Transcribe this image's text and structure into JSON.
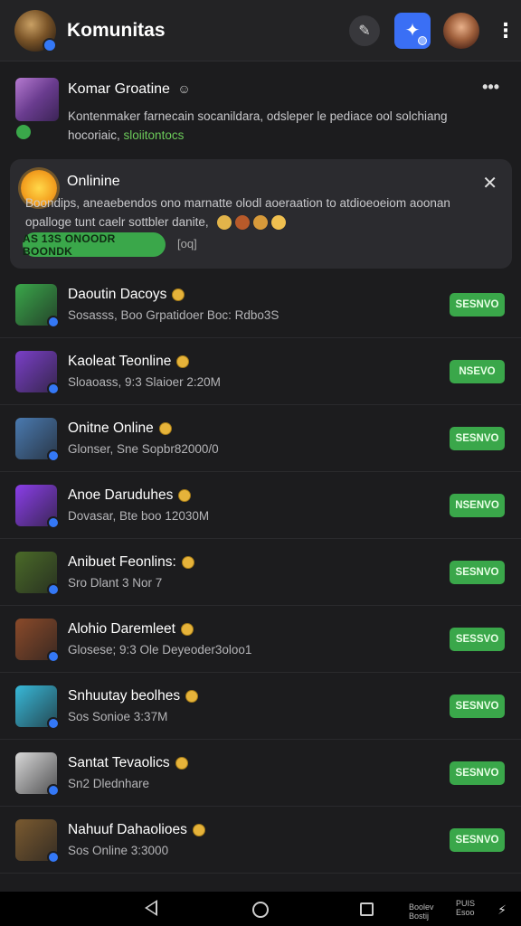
{
  "header": {
    "title": "Komunitas",
    "search_icon": "pen-icon",
    "compose_icon": "star-icon"
  },
  "post": {
    "title": "Komar Groatine",
    "title_suffix": "☺",
    "body": "Kontenmaker farnecain socanildara, odsleper le pediace ool solchiang hocoriaic,",
    "link": "sloiitontocs",
    "more": "•••"
  },
  "online_card": {
    "title": "Onlinine",
    "body": "Boondips, aneaebendos ono marnatte olodl aoeraation to atdioeoeiom aoonan opalloge tunt caelr sottbler danite,",
    "button": "AS 13S ONOODR BOONDK",
    "aux": "[oq]",
    "close": "✕",
    "dot_colors": [
      "#e2b44a",
      "#b85a2a",
      "#d79a3a",
      "#f0c050"
    ]
  },
  "rows": [
    {
      "name": "Daoutin Dacoys",
      "sub": "Sosasss, Boo Grpatidoer Boc: Rdbo3S",
      "button": "SESNVO",
      "icon_color": "#3aa74a"
    },
    {
      "name": "Kaoleat Teonline",
      "sub": "Sloaoass, 9:3 Slaioer 2:20M",
      "button": "NSEVO",
      "icon_color": "#7a3fc8"
    },
    {
      "name": "Onitne Online",
      "sub": "Glonser, Sne Sopbr82000/0",
      "button": "SESNVO",
      "icon_color": "#4a7ab0"
    },
    {
      "name": "Anoe Daruduhes",
      "sub": "Dovasar, Bte boo 12030M",
      "button": "NSENVO",
      "icon_color": "#8a3ee8"
    },
    {
      "name": "Anibuet Feonlins:",
      "sub": "Sro Dlant 3 Nor 7",
      "button": "SESNVO",
      "icon_color": "#4a6a28"
    },
    {
      "name": "Alohio Daremleet",
      "sub": "Glosese; 9:3 Ole Deyeoder3oloo1",
      "button": "SESSVO",
      "icon_color": "#8a4a2a"
    },
    {
      "name": "Snhuutay beolhes",
      "sub": "Sos Sonioe 3:37M",
      "button": "SESNVO",
      "icon_color": "#38b8d8"
    },
    {
      "name": "Santat Tevaolics",
      "sub": "Sn2 Dlednhare",
      "button": "SESNVO",
      "icon_color": "#d8d8d8"
    },
    {
      "name": "Nahuuf Dahaolioes",
      "sub": "Sos Online 3:3000",
      "button": "SESNVO",
      "icon_color": "#7a5a30"
    }
  ],
  "navbar": {
    "status_left": "Boolev\nBostij",
    "status_right": "PUIS\nEsoo"
  }
}
